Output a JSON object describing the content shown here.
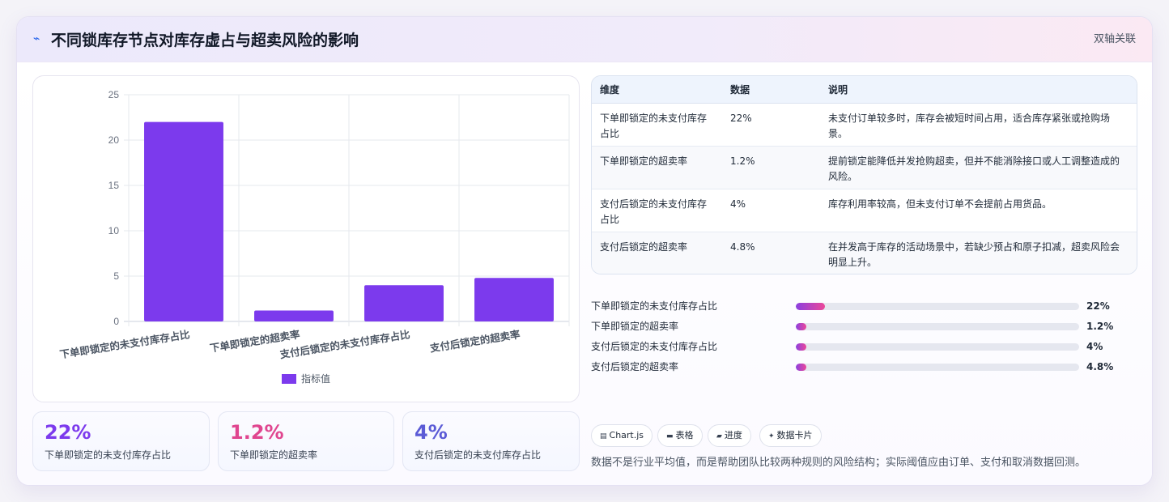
{
  "header": {
    "icon": "trend-line-icon",
    "title": "不同锁库存节点对库存虚占与超卖风险的影响",
    "link": "双轴关联"
  },
  "chart_data": {
    "type": "bar",
    "categories": [
      "下单即锁定的未支付库存占比",
      "下单即锁定的超卖率",
      "支付后锁定的未支付库存占比",
      "支付后锁定的超卖率"
    ],
    "series": [
      {
        "name": "指标值",
        "values": [
          22,
          1.2,
          4,
          4.8
        ],
        "color": "#7c3aed"
      }
    ],
    "ylim": [
      0,
      25
    ],
    "yticks": [
      0,
      5,
      10,
      15,
      20,
      25
    ],
    "grid": true,
    "legend": "bottom"
  },
  "stats": [
    {
      "value": "22%",
      "label": "下单即锁定的未支付库存占比",
      "color": "#7c3aed"
    },
    {
      "value": "1.2%",
      "label": "下单即锁定的超卖率",
      "color": "#e0458f"
    },
    {
      "value": "4%",
      "label": "支付后锁定的未支付库存占比",
      "color": "#5b5bd6"
    }
  ],
  "table": {
    "headers": [
      "维度",
      "数据",
      "说明"
    ],
    "rows": [
      [
        "下单即锁定的未支付库存占比",
        "22%",
        "未支付订单较多时，库存会被短时间占用，适合库存紧张或抢购场景。"
      ],
      [
        "下单即锁定的超卖率",
        "1.2%",
        "提前锁定能降低并发抢购超卖，但并不能消除接口或人工调整造成的风险。"
      ],
      [
        "支付后锁定的未支付库存占比",
        "4%",
        "库存利用率较高，但未支付订单不会提前占用货品。"
      ],
      [
        "支付后锁定的超卖率",
        "4.8%",
        "在并发高于库存的活动场景中，若缺少预占和原子扣减，超卖风险会明显上升。"
      ]
    ]
  },
  "progress": [
    {
      "label": "下单即锁定的未支付库存占比",
      "value": "22%",
      "fraction": 0.22
    },
    {
      "label": "下单即锁定的超卖率",
      "value": "1.2%",
      "fraction": 0.012
    },
    {
      "label": "支付后锁定的未支付库存占比",
      "value": "4%",
      "fraction": 0.04
    },
    {
      "label": "支付后锁定的超卖率",
      "value": "4.8%",
      "fraction": 0.048
    }
  ],
  "tags": [
    {
      "icon": "chart-icon",
      "glyph": "▤",
      "label": "Chart.js"
    },
    {
      "icon": "table-icon",
      "glyph": "▬",
      "label": "表格"
    },
    {
      "icon": "progress-icon",
      "glyph": "▰",
      "label": "进度"
    },
    {
      "icon": "sparkle-icon",
      "glyph": "✦",
      "label": "数据卡片"
    }
  ],
  "note": "数据不是行业平均值，而是帮助团队比较两种规则的风险结构；实际阈值应由订单、支付和取消数据回测。"
}
